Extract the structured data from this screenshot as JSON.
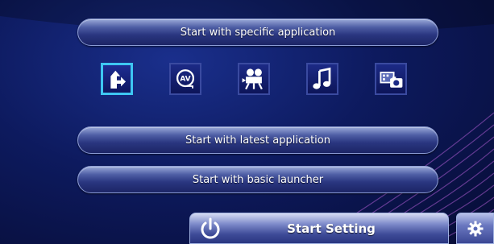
{
  "buttons": {
    "specific_app": "Start with specific application",
    "latest_app": "Start with latest application",
    "basic_launcher": "Start with basic launcher",
    "start_setting": "Start Setting"
  },
  "apps": [
    {
      "icon": "navigation-arrow-icon",
      "selected": true
    },
    {
      "icon": "av-input-icon",
      "selected": false
    },
    {
      "icon": "video-camera-icon",
      "selected": false
    },
    {
      "icon": "music-note-icon",
      "selected": false
    },
    {
      "icon": "photo-viewer-icon",
      "selected": false
    }
  ],
  "colors": {
    "background": "#0d1a5e",
    "selected_border": "#3ec6f2",
    "button_text": "#ffffff"
  }
}
